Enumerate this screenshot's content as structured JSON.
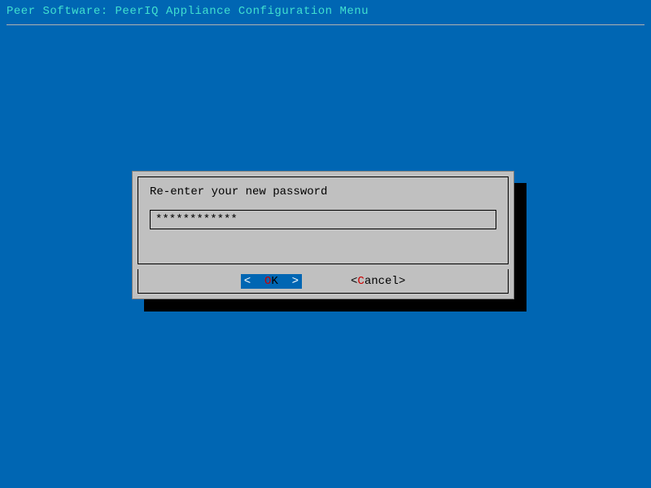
{
  "header": {
    "title": "Peer Software: PeerIQ Appliance Configuration Menu"
  },
  "dialog": {
    "prompt": "Re-enter your new password",
    "password_value": "************",
    "buttons": {
      "ok": {
        "left_bracket": "<  ",
        "hotkey": "O",
        "rest": "K  ",
        "right_bracket": ">"
      },
      "cancel": {
        "left_bracket": "<",
        "hotkey": "C",
        "rest": "ancel",
        "right_bracket": ">"
      }
    }
  }
}
